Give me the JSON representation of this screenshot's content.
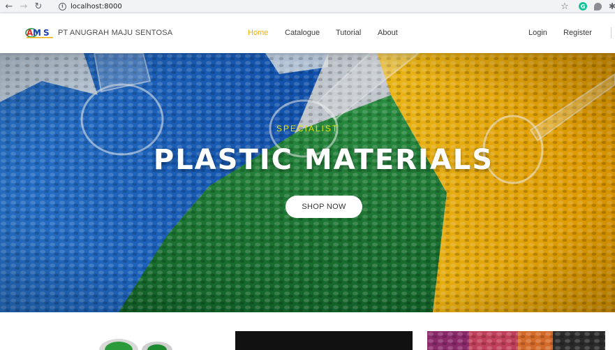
{
  "browser": {
    "url": "localhost:8000",
    "back_icon": "arrow-left-icon",
    "forward_icon": "arrow-right-icon",
    "reload_icon": "reload-icon",
    "info_icon": "info-icon",
    "bookmark_icon": "star-icon",
    "extensions": [
      "grammarly-icon",
      "extension-icon",
      "puzzle-icon"
    ]
  },
  "header": {
    "logo_text": "AMS",
    "brand": "PT ANUGRAH MAJU SENTOSA",
    "nav": [
      {
        "label": "Home",
        "active": true
      },
      {
        "label": "Catalogue",
        "active": false
      },
      {
        "label": "Tutorial",
        "active": false
      },
      {
        "label": "About",
        "active": false
      }
    ],
    "auth": [
      {
        "label": "Login"
      },
      {
        "label": "Register"
      }
    ],
    "active_color": "#f0b000"
  },
  "hero": {
    "eyebrow": "SPECIALIST",
    "title": "PLASTIC MATERIALS",
    "cta": "SHOP NOW",
    "colors": {
      "blue": "#1f6fd6",
      "green": "#1f8a3a",
      "yellow": "#f5b800",
      "eyebrow": "#e5e500"
    }
  }
}
